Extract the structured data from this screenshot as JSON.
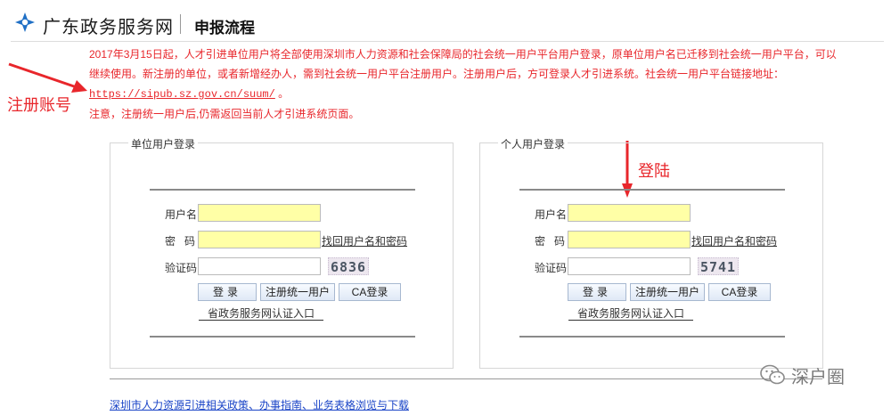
{
  "header": {
    "site_title": "广东政务服务网",
    "page_title": "申报流程"
  },
  "notice": {
    "line1": "2017年3月15日起，人才引进单位用户将全部使用深圳市人力资源和社会保障局的社会统一用户平台用户登录，原单位用户名已迁移到社会统一用户平台，可以继续使用。新注册的单位，或者新增经办人，需到社会统一用户平台注册用户。注册用户后，方可登录人才引进系统。社会统一用户平台链接地址：",
    "link": "https://sipub.sz.gov.cn/suum/",
    "link_suffix": " 。",
    "line2": "注意，注册统一用户后,仍需返回当前人才引进系统页面。"
  },
  "annotations": {
    "register": "注册账号",
    "login": "登陆"
  },
  "unit_panel": {
    "title": "单位用户登录",
    "username_label": "用户名",
    "password_label": "密码",
    "captcha_label": "验证码",
    "find_link": "找回用户名和密码",
    "captcha_code": "6836",
    "login_button": "登录",
    "register_button": "注册统一用户",
    "ca_button": "CA登录",
    "cert_link": "省政务服务网认证入口"
  },
  "person_panel": {
    "title": "个人用户登录",
    "username_label": "用户名",
    "password_label": "密码",
    "captcha_label": "验证码",
    "find_link": "找回用户名和密码",
    "captcha_code": "5741",
    "login_button": "登录",
    "register_button": "注册统一用户",
    "ca_button": "CA登录",
    "cert_link": "省政务服务网认证入口"
  },
  "footer": {
    "link": "深圳市人力资源引进相关政策、办事指南、业务表格浏览与下载"
  },
  "watermark": {
    "text": "深户圈"
  },
  "colors": {
    "notice_red": "#e8262b",
    "input_yellow": "#ffffa6",
    "footer_link_blue": "#1a44c7"
  }
}
